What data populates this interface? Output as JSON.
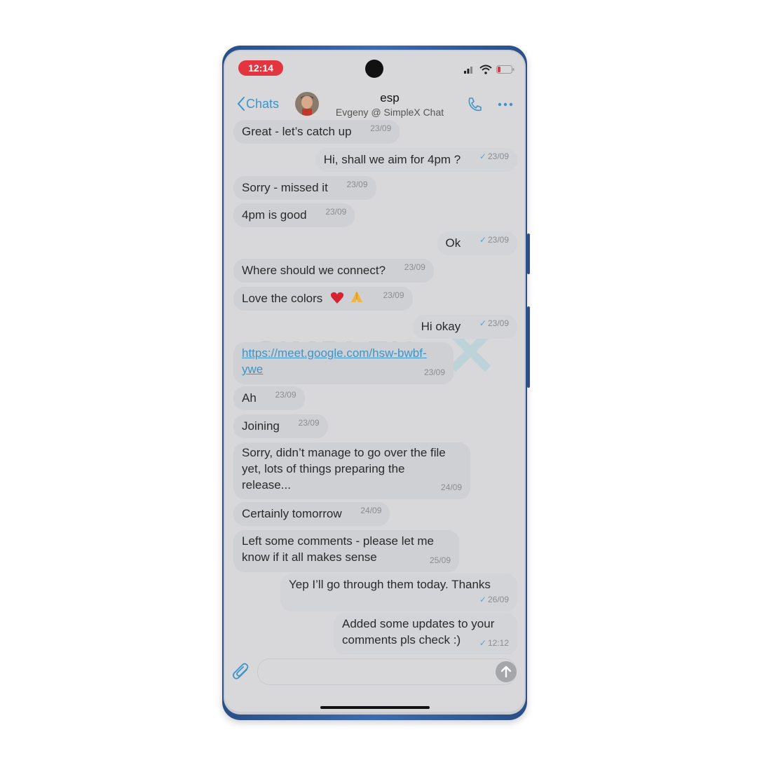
{
  "status": {
    "time": "12:14"
  },
  "header": {
    "back_label": "Chats",
    "contact_name": "esp",
    "contact_subtitle": "Evgeny @ SimpleX Chat"
  },
  "colors": {
    "accent": "#3d94c9",
    "time_pill": "#e2353f",
    "screen_bg": "#d8d8da"
  },
  "icons": [
    "chevron-left-icon",
    "phone-icon",
    "more-icon",
    "paperclip-icon",
    "arrow-up-icon",
    "signal-icon",
    "wifi-icon",
    "battery-icon"
  ],
  "messages": [
    {
      "dir": "in",
      "text": "Great - let’s catch up",
      "time": "23/09"
    },
    {
      "dir": "out",
      "text": "Hi, shall we aim for 4pm ?",
      "time": "23/09",
      "check": "✓"
    },
    {
      "dir": "in",
      "text": "Sorry - missed it",
      "time": "23/09"
    },
    {
      "dir": "in",
      "text": "4pm is good",
      "time": "23/09"
    },
    {
      "dir": "out",
      "text": "Ok",
      "time": "23/09",
      "check": "✓"
    },
    {
      "dir": "in",
      "text": "Where should we connect?",
      "time": "23/09"
    },
    {
      "dir": "in",
      "text": "Love the colors",
      "time": "23/09"
    },
    {
      "dir": "out",
      "text": "Hi okay",
      "time": "23/09",
      "check": "✓"
    },
    {
      "dir": "in",
      "text_line1": "https://meet.google.com/hsw-bwbf-",
      "text_line2": "ywe",
      "time": "23/09"
    },
    {
      "dir": "in",
      "text": "Ah",
      "time": "23/09"
    },
    {
      "dir": "in",
      "text": "Joining",
      "time": "23/09"
    },
    {
      "dir": "in",
      "text_line1": "Sorry, didn’t manage to go over the file",
      "text_line2": "yet, lots of things preparing the",
      "text_line3": "release...",
      "time": "24/09"
    },
    {
      "dir": "in",
      "text": "Certainly tomorrow",
      "time": "24/09"
    },
    {
      "dir": "in",
      "text_line1": "Left some comments - please let me",
      "text_line2": "know if it all makes sense",
      "time": "25/09"
    },
    {
      "dir": "out",
      "text": "Yep I’ll go through them today. Thanks",
      "time": "26/09",
      "check": "✓"
    },
    {
      "dir": "out",
      "text_line1": "Added some updates to your",
      "text_line2": "comments pls check :)",
      "time": "12:12",
      "check": "✓"
    }
  ],
  "watermark": "SIMPLEX"
}
